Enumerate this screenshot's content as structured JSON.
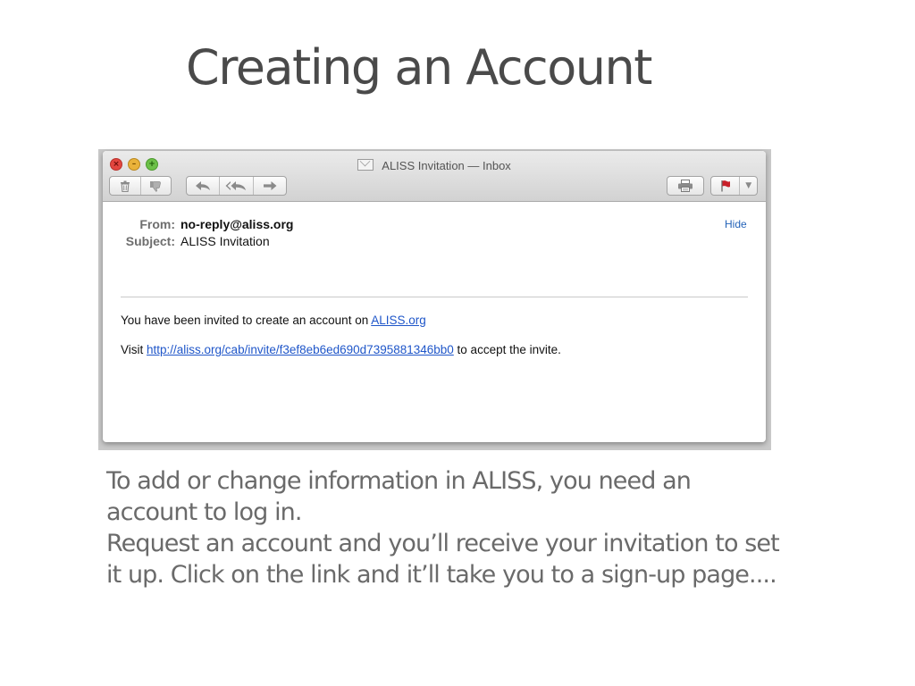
{
  "slide": {
    "title": "Creating an Account",
    "caption_lines": [
      "To add or change information in ALISS, you need an account to log in.",
      "Request an account and you’ll receive your invitation to set it up. Click on the link and it’ll take you to a sign-up page...."
    ]
  },
  "window": {
    "title": "ALISS Invitation — Inbox",
    "title_icon": "envelope-icon"
  },
  "toolbar": {
    "traffic_close_glyph": "×",
    "traffic_min_glyph": "–",
    "traffic_zoom_glyph": "+",
    "delete_icon": "trash-icon",
    "junk_icon": "thumbs-down-icon",
    "reply_icon": "reply-icon",
    "reply_all_icon": "reply-all-icon",
    "forward_icon": "forward-icon",
    "print_icon": "printer-icon",
    "flag_icon": "flag-icon",
    "flag_color": "#c8202a"
  },
  "message": {
    "from_label": "From:",
    "from_value": "no-reply@aliss.org",
    "subject_label": "Subject:",
    "subject_value": "ALISS Invitation",
    "hide_label": "Hide",
    "body_line1_prefix": "You have been invited to create an account on ",
    "body_line1_link": "ALISS.org",
    "body_line2_prefix": "Visit ",
    "body_line2_link": "http://aliss.org/cab/invite/f3ef8eb6ed690d7395881346bb0",
    "body_line2_suffix": " to accept the invite.",
    "link_color": "#1f56c9"
  }
}
